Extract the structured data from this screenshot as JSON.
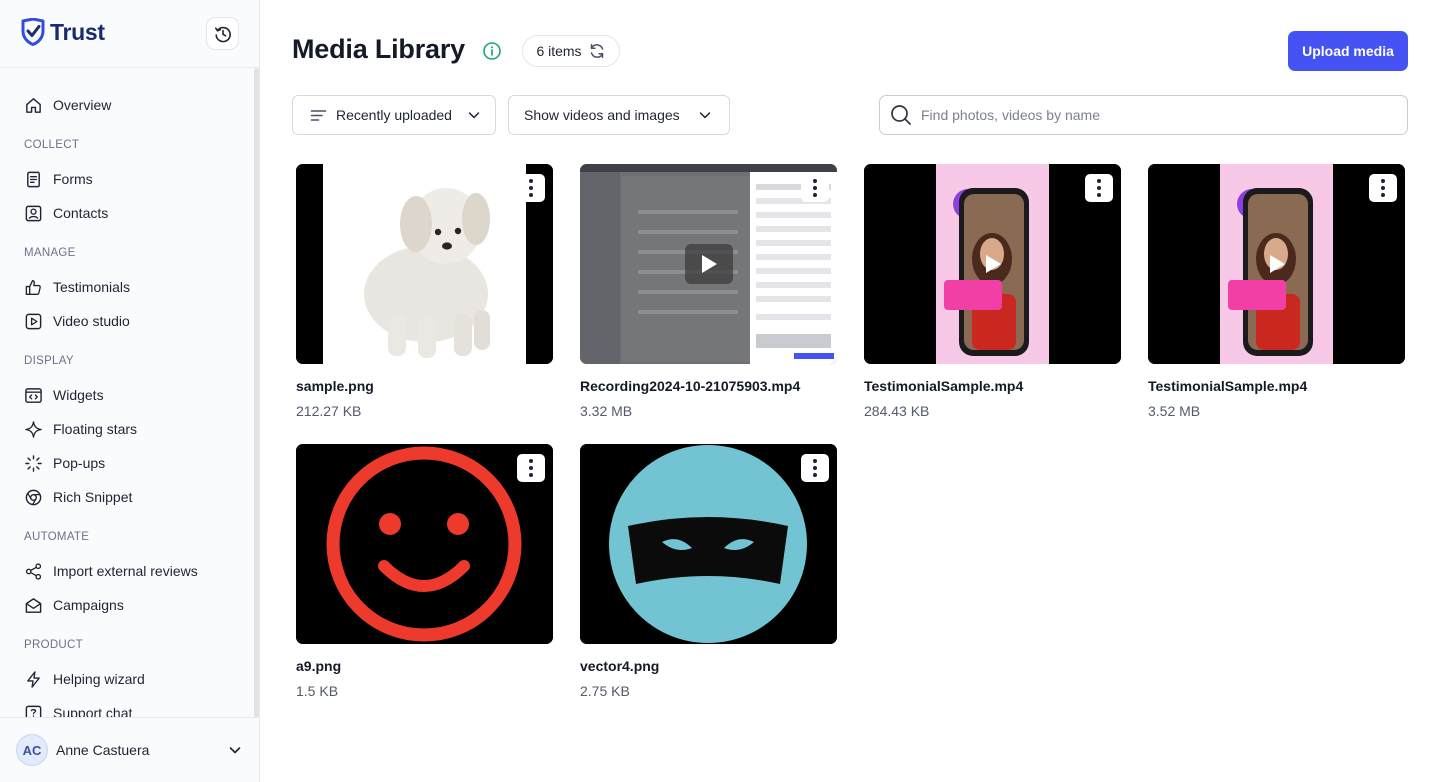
{
  "app": {
    "brand": "Trust"
  },
  "sidebar": {
    "items": [
      {
        "label": "Overview"
      },
      {
        "label": "Forms"
      },
      {
        "label": "Contacts"
      },
      {
        "label": "Testimonials"
      },
      {
        "label": "Video studio"
      },
      {
        "label": "Widgets"
      },
      {
        "label": "Floating stars"
      },
      {
        "label": "Pop-ups"
      },
      {
        "label": "Rich Snippet"
      },
      {
        "label": "Import external reviews"
      },
      {
        "label": "Campaigns"
      },
      {
        "label": "Helping wizard"
      },
      {
        "label": "Support chat"
      }
    ],
    "sections": [
      "COLLECT",
      "MANAGE",
      "DISPLAY",
      "AUTOMATE",
      "PRODUCT"
    ]
  },
  "user": {
    "initials": "AC",
    "name": "Anne Castuera"
  },
  "header": {
    "title": "Media Library",
    "items_count": "6 items",
    "upload_label": "Upload media"
  },
  "filters": {
    "sort_value": "Recently uploaded",
    "type_value": "Show videos and images",
    "search_placeholder": "Find photos, videos by name"
  },
  "media": [
    {
      "name": "sample.png",
      "size": "212.27 KB",
      "kind": "image"
    },
    {
      "name": "Recording2024-10-21075903.mp4",
      "size": "3.32 MB",
      "kind": "video"
    },
    {
      "name": "TestimonialSample.mp4",
      "size": "284.43 KB",
      "kind": "video"
    },
    {
      "name": "TestimonialSample.mp4",
      "size": "3.52 MB",
      "kind": "video"
    },
    {
      "name": "a9.png",
      "size": "1.5 KB",
      "kind": "image"
    },
    {
      "name": "vector4.png",
      "size": "2.75 KB",
      "kind": "image"
    }
  ],
  "colors": {
    "accent": "#4553f5",
    "brand_navy": "#1c2b6b",
    "info_green": "#1ea672",
    "smiley_red": "#ee3a2c",
    "ninja_teal": "#72c4d2",
    "pink_bg": "#f7c9e6"
  }
}
